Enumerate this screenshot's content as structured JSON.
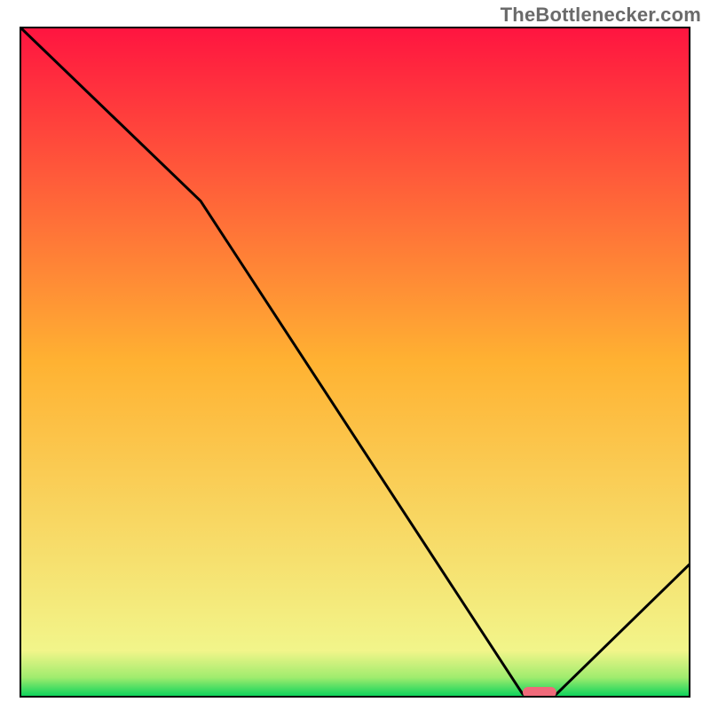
{
  "attribution": "TheBottlenecker.com",
  "chart_data": {
    "type": "line",
    "title": "",
    "xlabel": "",
    "ylabel": "",
    "xlim": [
      0,
      100
    ],
    "ylim": [
      0,
      100
    ],
    "grid": false,
    "legend": false,
    "background_gradient": {
      "stops": [
        {
          "y": 0,
          "color": "#00d15a"
        },
        {
          "y": 3,
          "color": "#a0ec6e"
        },
        {
          "y": 7,
          "color": "#f2f58a"
        },
        {
          "y": 50,
          "color": "#ffb232"
        },
        {
          "y": 100,
          "color": "#ff1440"
        }
      ]
    },
    "series": [
      {
        "name": "bottleneck-curve",
        "color": "#000000",
        "x": [
          0,
          27,
          75,
          80,
          100
        ],
        "y": [
          100,
          74,
          0.5,
          0.5,
          20
        ]
      }
    ],
    "marker": {
      "name": "optimal-range",
      "shape": "rounded-bar",
      "color": "#f06a7a",
      "x_start": 75,
      "x_end": 80,
      "y": 0.8
    }
  }
}
